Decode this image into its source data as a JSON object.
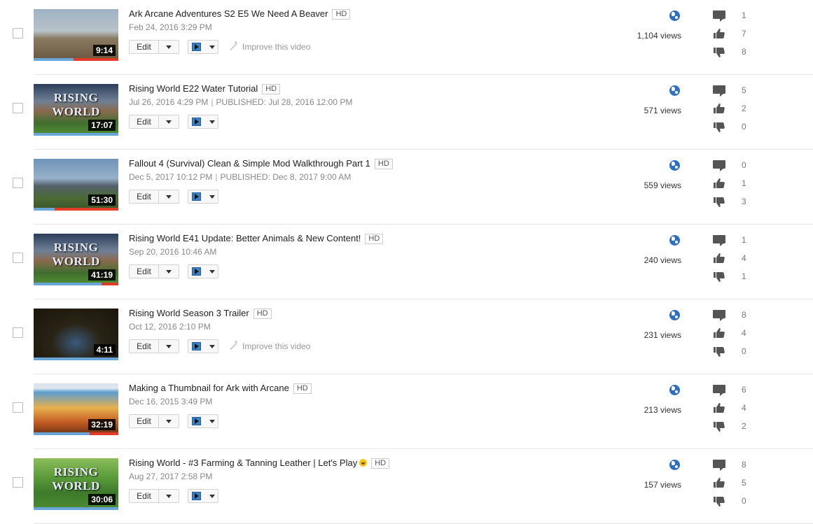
{
  "videos": [
    {
      "title": "Ark Arcane Adventures S2 E5 We Need A Beaver",
      "hd": "HD",
      "date": "Feb 24, 2016 3:29 PM",
      "published": "",
      "duration": "9:14",
      "edit_label": "Edit",
      "improve": "Improve this video",
      "views": "1,104 views",
      "comments": "1",
      "likes": "7",
      "dislikes": "8",
      "watched_fraction": 0.47,
      "brand": ""
    },
    {
      "title": "Rising World E22 Water Tutorial",
      "hd": "HD",
      "date": "Jul 26, 2016 4:29 PM",
      "published": "PUBLISHED: Jul 28, 2016 12:00 PM",
      "duration": "17:07",
      "edit_label": "Edit",
      "improve": "",
      "views": "571 views",
      "comments": "5",
      "likes": "2",
      "dislikes": "0",
      "watched_fraction": 1.0,
      "brand": "RISING WORLD"
    },
    {
      "title": "Fallout 4 (Survival) Clean & Simple Mod Walkthrough Part 1",
      "hd": "HD",
      "date": "Dec 5, 2017 10:12 PM",
      "published": "PUBLISHED: Dec 8, 2017 9:00 AM",
      "duration": "51:30",
      "edit_label": "Edit",
      "improve": "",
      "views": "559 views",
      "comments": "0",
      "likes": "1",
      "dislikes": "3",
      "watched_fraction": 0.25,
      "brand": ""
    },
    {
      "title": "Rising World E41 Update: Better Animals & New Content!",
      "hd": "HD",
      "date": "Sep 20, 2016 10:46 AM",
      "published": "",
      "duration": "41:19",
      "edit_label": "Edit",
      "improve": "",
      "views": "240 views",
      "comments": "1",
      "likes": "4",
      "dislikes": "1",
      "watched_fraction": 0.8,
      "brand": "RISING WORLD"
    },
    {
      "title": "Rising World Season 3 Trailer",
      "hd": "HD",
      "date": "Oct 12, 2016 2:10 PM",
      "published": "",
      "duration": "4:11",
      "edit_label": "Edit",
      "improve": "Improve this video",
      "views": "231 views",
      "comments": "8",
      "likes": "4",
      "dislikes": "0",
      "watched_fraction": 1.0,
      "brand": ""
    },
    {
      "title": "Making a Thumbnail for Ark with Arcane",
      "hd": "HD",
      "date": "Dec 16, 2015 3:49 PM",
      "published": "",
      "duration": "32:19",
      "edit_label": "Edit",
      "improve": "",
      "views": "213 views",
      "comments": "6",
      "likes": "4",
      "dislikes": "2",
      "watched_fraction": 0.66,
      "brand": ""
    },
    {
      "title": "Rising World - #3 Farming & Tanning Leather | Let's Play",
      "hd": "HD",
      "date": "Aug 27, 2017 2:58 PM",
      "published": "",
      "duration": "30:06",
      "edit_label": "Edit",
      "improve": "",
      "views": "157 views",
      "comments": "8",
      "likes": "5",
      "dislikes": "0",
      "watched_fraction": 1.0,
      "brand": "RISING WORLD",
      "emoji": true
    }
  ],
  "icons": {
    "visibility": "globe-icon",
    "comments": "comment-icon",
    "likes": "thumbs-up-icon",
    "dislikes": "thumbs-down-icon"
  },
  "colors": {
    "progress": "#6aa5d8",
    "progress_remaining": "#e23b2a",
    "globe": "#2e6fbf"
  }
}
